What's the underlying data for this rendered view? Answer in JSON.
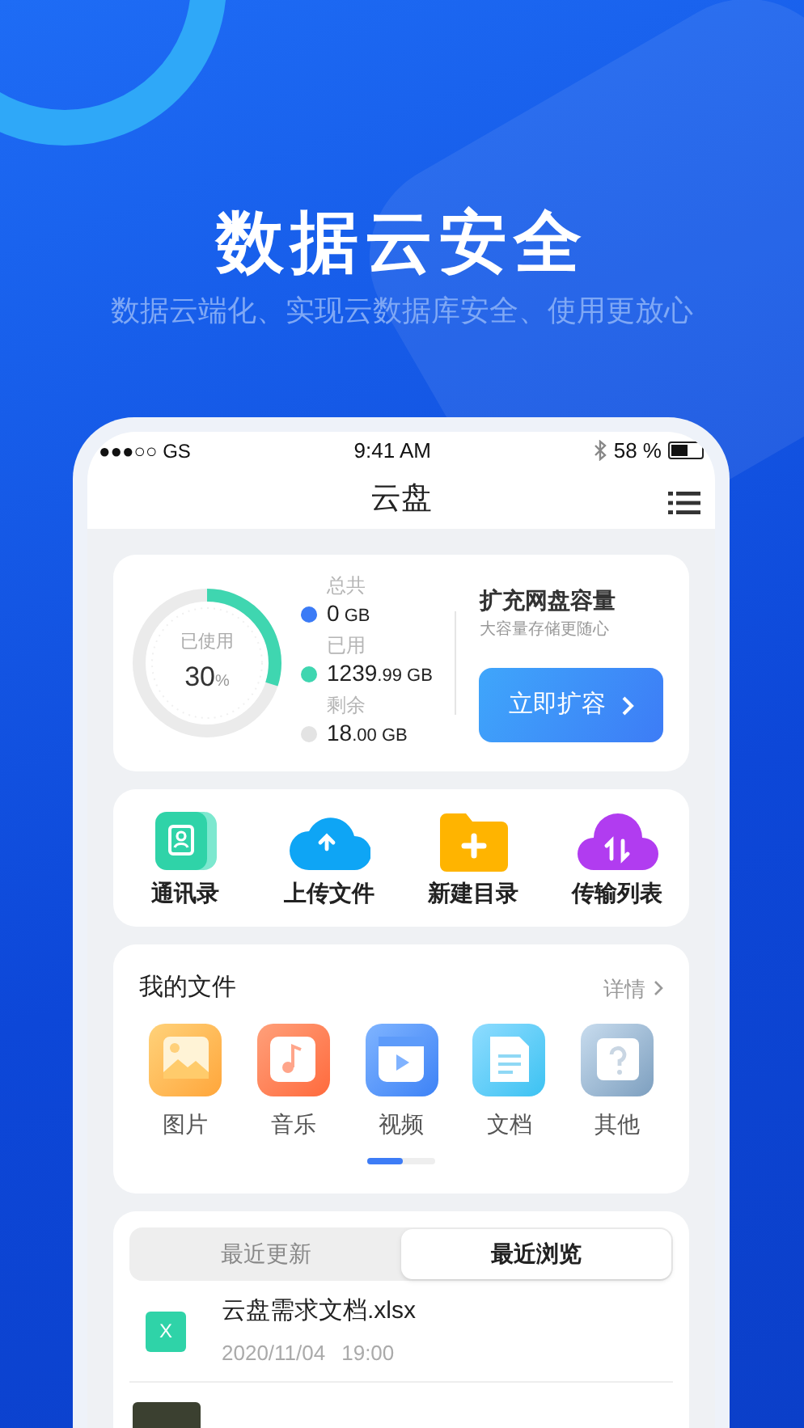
{
  "hero": {
    "title": "数据云安全",
    "subtitle": "数据云端化、实现云数据库安全、使用更放心"
  },
  "status_bar": {
    "carrier": "●●●○○ GS",
    "time": "9:41 AM",
    "battery": {
      "text": "58 %",
      "level": 0.58
    }
  },
  "nav": {
    "title": "云盘"
  },
  "storage": {
    "ring_label": "已使用",
    "percent": "30",
    "percent_unit": "%",
    "level": 0.3,
    "stats": [
      {
        "label": "总共",
        "value": "0",
        "unit": "GB",
        "color": "#3b7bf6"
      },
      {
        "label": "已用",
        "value": "1239",
        "decimal": ".99",
        "unit": "GB",
        "color": "#3fd6b0"
      },
      {
        "label": "剩余",
        "value": "18",
        "decimal": ".00",
        "unit": "GB",
        "color": "#e3e3e3"
      }
    ],
    "promo_title": "扩充网盘容量",
    "promo_subtitle": "大容量存储更随心",
    "button": "立即扩容"
  },
  "actions": [
    {
      "label": "通讯录",
      "kind": "contacts"
    },
    {
      "label": "上传文件",
      "kind": "upload"
    },
    {
      "label": "新建目录",
      "kind": "folder"
    },
    {
      "label": "传输列表",
      "kind": "transfer"
    }
  ],
  "my_files": {
    "title": "我的文件",
    "more": "详情",
    "items": [
      {
        "label": "图片",
        "kind": "image"
      },
      {
        "label": "音乐",
        "kind": "music"
      },
      {
        "label": "视频",
        "kind": "video"
      },
      {
        "label": "文档",
        "kind": "doc"
      },
      {
        "label": "其他",
        "kind": "other"
      }
    ]
  },
  "recent": {
    "tabs": [
      {
        "label": "最近更新",
        "selected": false
      },
      {
        "label": "最近浏览",
        "selected": true
      }
    ],
    "files": [
      {
        "kind": "xlsx",
        "icon_text": "X",
        "name": "云盘需求文档.xlsx",
        "date": "2020/11/04",
        "time": "19:00"
      },
      {
        "kind": "photo"
      }
    ]
  }
}
